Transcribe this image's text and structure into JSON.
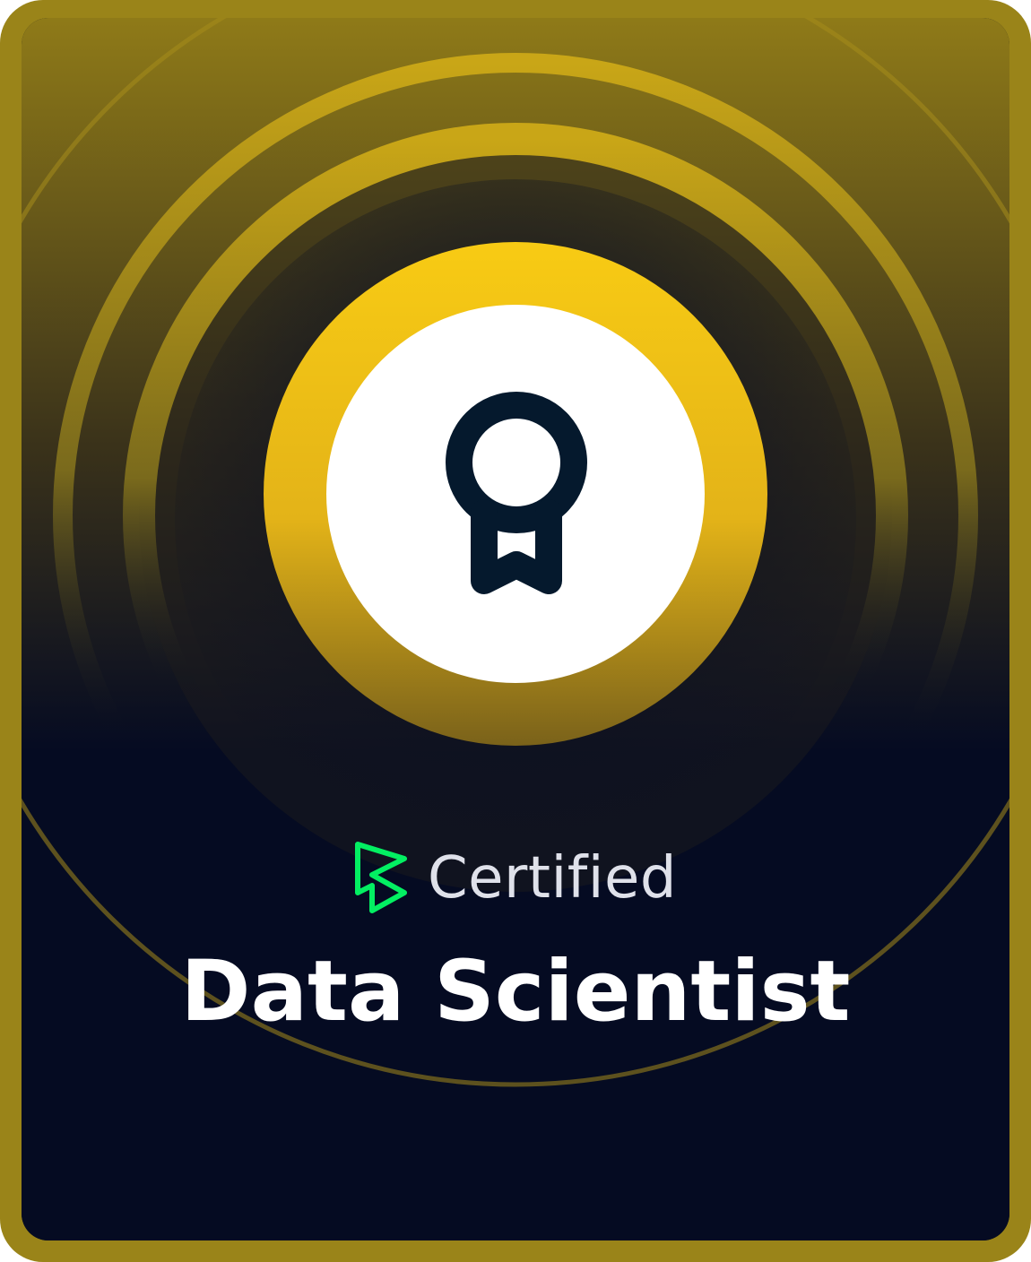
{
  "badge": {
    "label": "Certified",
    "title": "Data Scientist",
    "icon": "award-ribbon-icon",
    "logo": "datacamp-logo-icon"
  },
  "colors": {
    "frame_gold": "#9a8419",
    "disc_gold": "#f8cb14",
    "background_navy": "#050b22",
    "icon_navy": "#05192d",
    "logo_green": "#03ef62",
    "text_light": "#dfe1ea",
    "text_white": "#ffffff"
  }
}
